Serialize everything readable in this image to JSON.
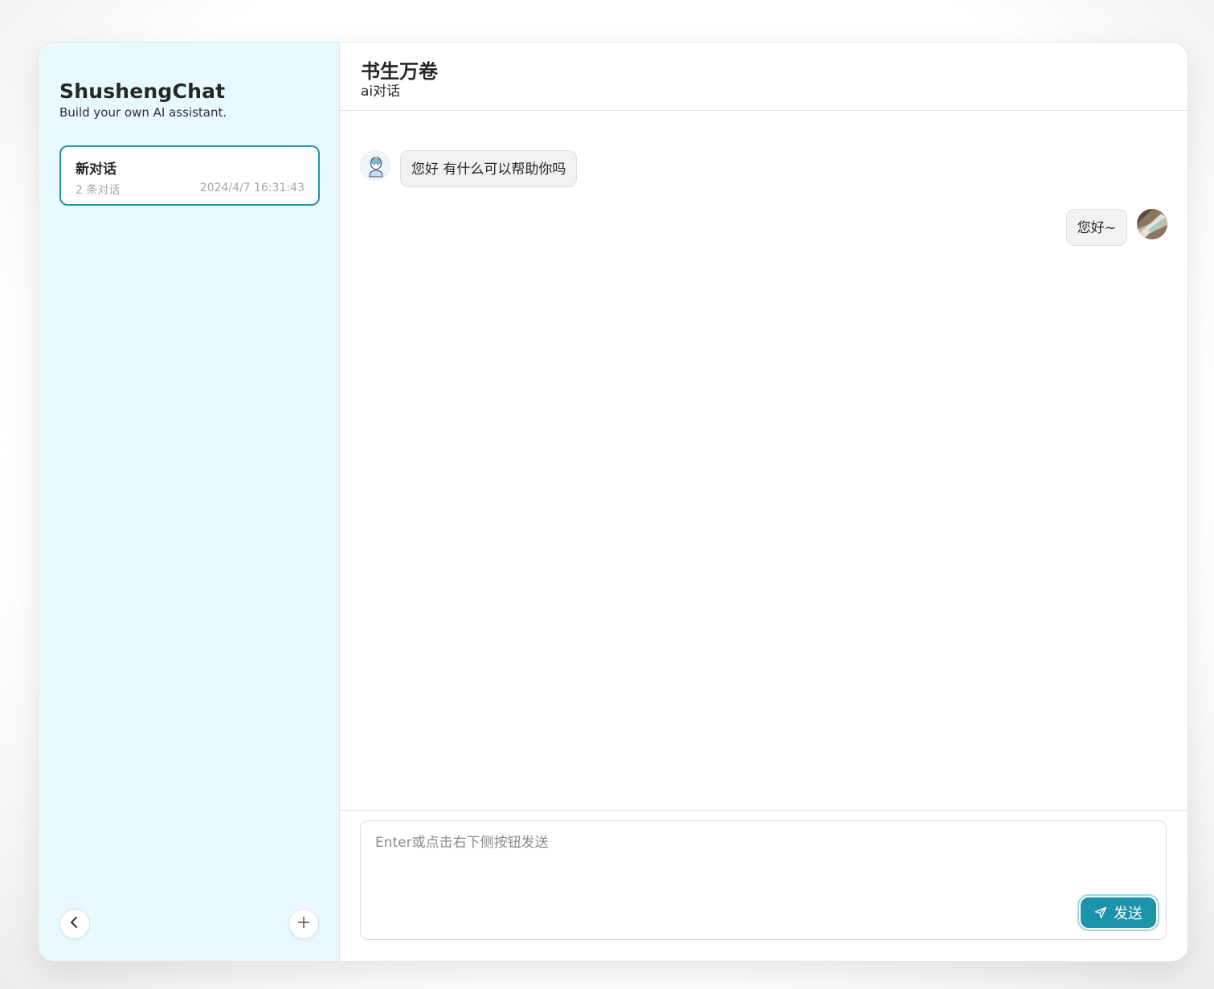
{
  "sidebar": {
    "title": "ShushengChat",
    "subtitle": "Build your own AI assistant.",
    "chats": [
      {
        "title": "新对话",
        "count": "2 条对话",
        "time": "2024/4/7 16:31:43"
      }
    ],
    "collapse_icon": "chevron-left-icon",
    "new_chat_icon": "plus-icon",
    "background_color": "#e7f8ff",
    "accent_color": "#1d93ab"
  },
  "header": {
    "title": "书生万卷",
    "subtitle": "ai对话"
  },
  "messages": [
    {
      "role": "assistant",
      "text": "您好 有什么可以帮助你吗",
      "avatar": "bot-avatar"
    },
    {
      "role": "user",
      "text": "您好~",
      "avatar": "user-avatar"
    }
  ],
  "composer": {
    "placeholder": "Enter或点击右下侧按钮发送",
    "value": "",
    "send_label": "发送",
    "send_icon": "send-icon"
  }
}
